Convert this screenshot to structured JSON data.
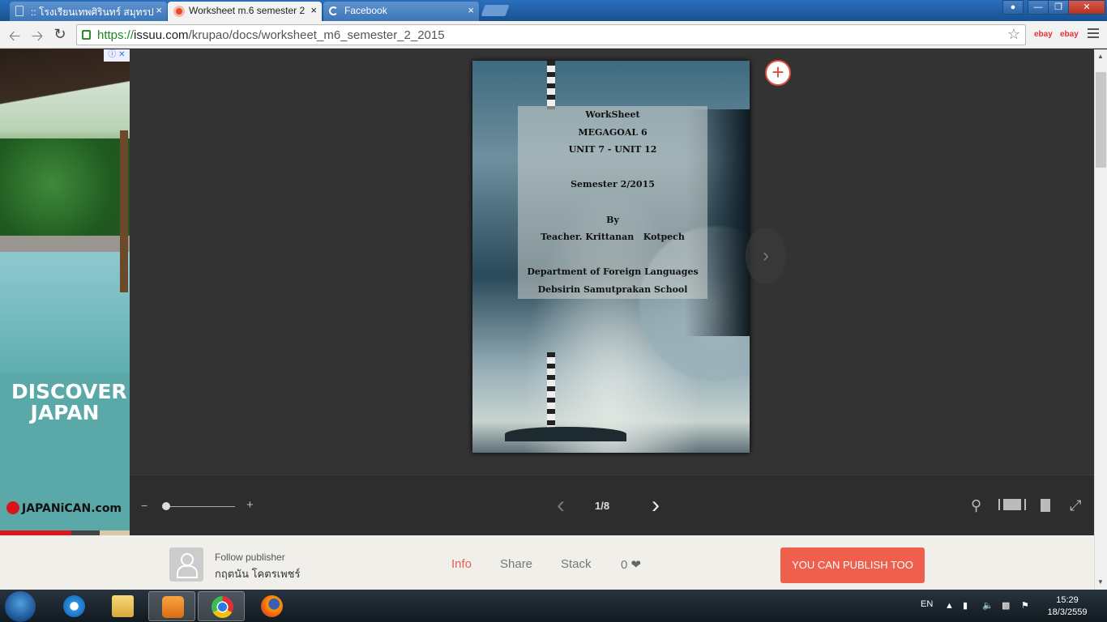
{
  "browser": {
    "tabs": [
      {
        "label": ":: โรงเรียนเทพศิรินทร์ สมุทรป",
        "active": false,
        "icon": "page-icon"
      },
      {
        "label": "Worksheet m.6 semester 2",
        "active": true,
        "icon": "issuu-icon"
      },
      {
        "label": "Facebook",
        "active": false,
        "icon": "loading-icon"
      }
    ],
    "url_scheme": "https://",
    "url_host": "issuu.com",
    "url_path": "/krupao/docs/worksheet_m6_semester_2_2015",
    "extensions": [
      "ebay",
      "ebay"
    ],
    "close_label": "×"
  },
  "ad": {
    "headline": "DISCOVER JAPAN",
    "brand": "JAPANiCAN.com"
  },
  "document": {
    "lines": [
      "WorkSheet",
      "MEGAGOAL 6",
      "UNIT 7 - UNIT 12",
      "",
      "Semester 2/2015",
      "",
      "By",
      "Teacher. Krittanan   Kotpech",
      "",
      "Department of Foreign Languages",
      "Debsirin Samutprakan School"
    ]
  },
  "controls": {
    "zoom_minus": "−",
    "zoom_plus": "+",
    "zoom_level": 0,
    "page_indicator": "1/8"
  },
  "bottombar": {
    "follow_label": "Follow publisher",
    "publisher_name": "กฤตนัน โคตรเพชร์",
    "info": "Info",
    "share": "Share",
    "stack": "Stack",
    "likes": "0",
    "publish_button": "YOU CAN PUBLISH TOO"
  },
  "taskbar": {
    "language": "EN",
    "time": "15:29",
    "date": "18/3/2559"
  },
  "colors": {
    "accent": "#ef5f4d",
    "info_active": "#e8604f"
  }
}
